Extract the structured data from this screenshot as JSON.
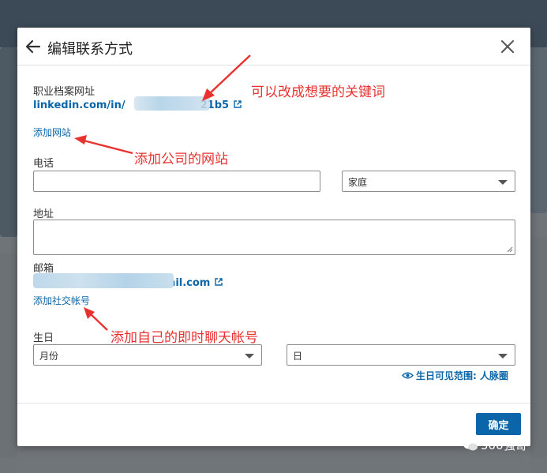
{
  "dialog": {
    "title": "编辑联系方式",
    "profile_url_label": "职业档案网址",
    "profile_url_prefix": "linkedin.com/in/",
    "profile_url_suffix": "21b5",
    "add_website": "添加网站",
    "phone_label": "电话",
    "phone_value": "",
    "phone_type": "家庭",
    "address_label": "地址",
    "address_value": "",
    "email_label": "邮箱",
    "email_suffix": "mail.com",
    "add_social": "添加社交帐号",
    "birthday_label": "生日",
    "birth_month": "月份",
    "birth_day": "日",
    "birthday_visibility": "生日可见范围: 人脉圈",
    "confirm": "确定"
  },
  "annotations": {
    "keyword": "可以改成想要的关键词",
    "company_site": "添加公司的网站",
    "chat_account": "添加自己的即时聊天帐号"
  },
  "watermark": "500强哥",
  "colors": {
    "accent": "#0a66a8",
    "annotation": "#e8322f"
  }
}
